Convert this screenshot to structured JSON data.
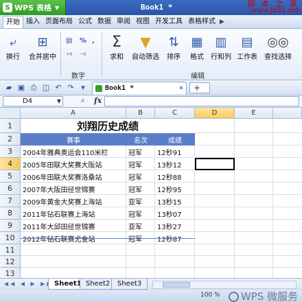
{
  "titlebar": {
    "app_button": "WPS 表格",
    "logo_letter": "S",
    "doc_title": "Book1 *",
    "watermark_line1": "脚 本 之 家",
    "watermark_line2": "www.Jb51.net"
  },
  "menu": {
    "tabs": [
      "开始",
      "插入",
      "页面布局",
      "公式",
      "数据",
      "审阅",
      "视图",
      "开发工具",
      "表格样式"
    ],
    "active_index": 0
  },
  "ribbon": {
    "wrap_label": "换行",
    "merge_label": "合并居中",
    "number_group": "数字",
    "percent": "%",
    "comma": ",",
    "sum_label": "求和",
    "autofilter_label": "自动筛选",
    "sort_label": "排序",
    "format_label": "格式",
    "rowcol_label": "行和列",
    "sheet_label": "工作表",
    "find_label": "查找选择",
    "edit_group": "编辑"
  },
  "toolbar": {
    "doc_tab": "Book1 *",
    "doc_tab_close": "×",
    "new_tab": "+"
  },
  "formula_bar": {
    "name_box": "D4",
    "zoom_icon": "⌕",
    "fx": "fx",
    "value": ""
  },
  "columns": [
    "A",
    "B",
    "C",
    "D",
    "E"
  ],
  "rows": [
    "1",
    "2",
    "3",
    "4",
    "5",
    "6",
    "7",
    "8",
    "9",
    "10",
    "11",
    "12",
    "13",
    "14"
  ],
  "sheet": {
    "title": "刘翔历史成绩",
    "headers": [
      "赛事",
      "名次",
      "成绩"
    ],
    "records": [
      {
        "event": "2004年雅典奥运会110米栏",
        "rank": "冠军",
        "time": "12秒91"
      },
      {
        "event": "2005年田联大奖赛大阪站",
        "rank": "冠军",
        "time": "13秒12"
      },
      {
        "event": "2006年田联大奖赛洛桑站",
        "rank": "冠军",
        "time": "12秒88"
      },
      {
        "event": "2007年大阪田径世锦赛",
        "rank": "冠军",
        "time": "12秒95"
      },
      {
        "event": "2009年黄金大奖赛上海站",
        "rank": "亚军",
        "time": "13秒15"
      },
      {
        "event": "2011年钻石联赛上海站",
        "rank": "冠军",
        "time": "13秒07"
      },
      {
        "event": "2011年大邱田径世锦赛",
        "rank": "亚军",
        "time": "13秒27"
      },
      {
        "event": "2012年钻石联赛尤金站",
        "rank": "冠军",
        "time": "12秒87"
      }
    ]
  },
  "sheets": [
    "Sheet1",
    "Sheet2",
    "Sheet3"
  ],
  "status": {
    "zoom": "100 %",
    "watermark": "WPS 微服务"
  },
  "colors": {
    "header_band": "#5b7ec8",
    "selected_header": "#f9c95e"
  }
}
